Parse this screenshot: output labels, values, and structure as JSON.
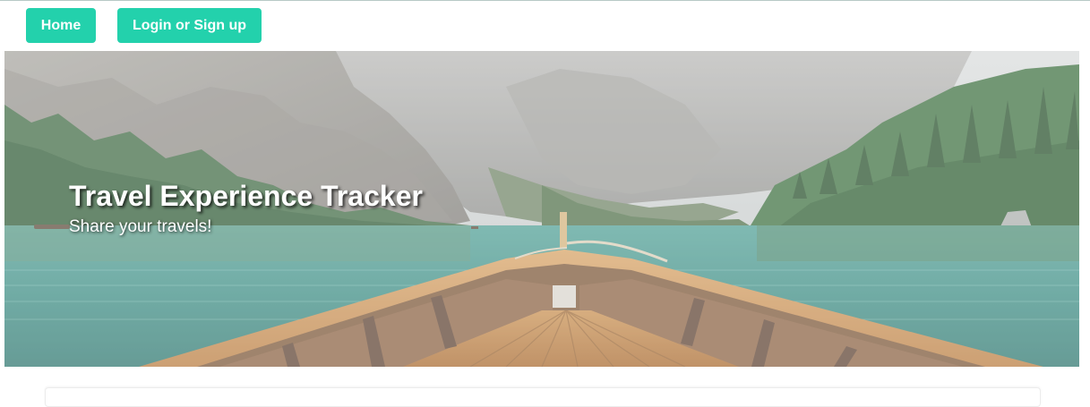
{
  "navbar": {
    "home_label": "Home",
    "login_label": "Login or Sign up"
  },
  "hero": {
    "title": "Travel Experience Tracker",
    "subtitle": "Share your travels!"
  },
  "colors": {
    "accent": "#23d1ac",
    "text_on_accent": "#ffffff"
  }
}
